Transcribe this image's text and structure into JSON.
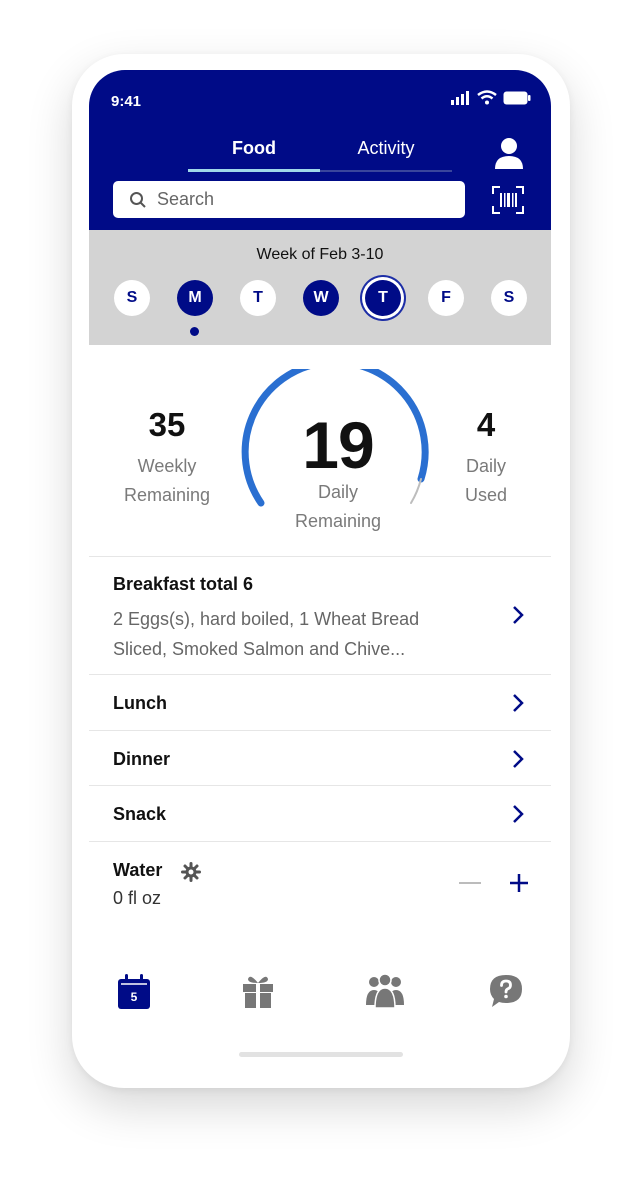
{
  "status": {
    "time": "9:41"
  },
  "tabs": {
    "food": "Food",
    "activity": "Activity"
  },
  "search": {
    "placeholder": "Search"
  },
  "week": {
    "title": "Week of Feb 3-10",
    "days": [
      "S",
      "M",
      "T",
      "W",
      "T",
      "F",
      "S"
    ]
  },
  "summary": {
    "weekly_value": "35",
    "weekly_label_1": "Weekly",
    "weekly_label_2": "Remaining",
    "daily_remaining_value": "19",
    "daily_remaining_label_1": "Daily",
    "daily_remaining_label_2": "Remaining",
    "daily_used_value": "4",
    "daily_used_label_1": "Daily",
    "daily_used_label_2": "Used"
  },
  "meals": {
    "breakfast_title": "Breakfast total 6",
    "breakfast_line_1": "2 Eggs(s), hard boiled, 1 Wheat Bread",
    "breakfast_line_2": "Sliced, Smoked Salmon and Chive...",
    "lunch": "Lunch",
    "dinner": "Dinner",
    "snack": "Snack"
  },
  "water": {
    "title": "Water",
    "amount": "0 fl oz"
  },
  "nav": {
    "calendar_day": "5"
  },
  "colors": {
    "primary": "#000b87",
    "accent_arc": "#2a6fd1",
    "week_bg": "#d3d3d3"
  }
}
